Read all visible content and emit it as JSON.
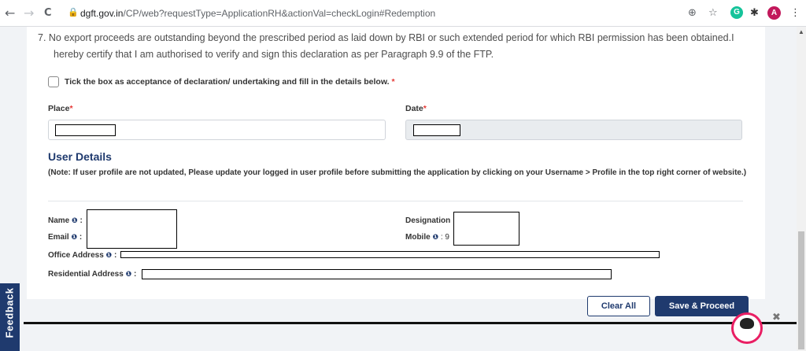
{
  "browser": {
    "back_icon": "←",
    "forward_icon": "→",
    "reload_icon": "C",
    "url_host": "dgft.gov.in",
    "url_path": "/CP/web?requestType=ApplicationRH&actionVal=checkLogin#Redemption",
    "profile_initial": "A",
    "grammarly_initial": "G"
  },
  "declaration": {
    "item7": "7. No export proceeds are outstanding beyond the prescribed period as laid down by RBI or such extended period for which RBI permission has been obtained.I",
    "item7_cont": "hereby certify that I am authorised to verify and sign this declaration as per Paragraph 9.9 of the FTP.",
    "tick_label": "Tick the box as acceptance of declaration/ undertaking and fill in the details below.",
    "required_mark": "*"
  },
  "form": {
    "place_label": "Place",
    "date_label": "Date",
    "required_mark": "*"
  },
  "user_details": {
    "title": "User Details",
    "note": "(Note: If user profile are not updated, Please update your logged in user profile before submitting the application by clicking on your Username > Profile in the top right corner of website.)",
    "name_label": "Name",
    "email_label": "Email",
    "designation_label": "Designation",
    "mobile_label": "Mobile",
    "mobile_value": ": 9",
    "office_label": "Office Address",
    "residential_label": "Residential Address",
    "sep": ":"
  },
  "feedback": "Feedback",
  "buttons": {
    "clear": "Clear All",
    "save": "Save & Proceed"
  },
  "colors": {
    "primary": "#1f3a6e",
    "required": "#e53935"
  }
}
